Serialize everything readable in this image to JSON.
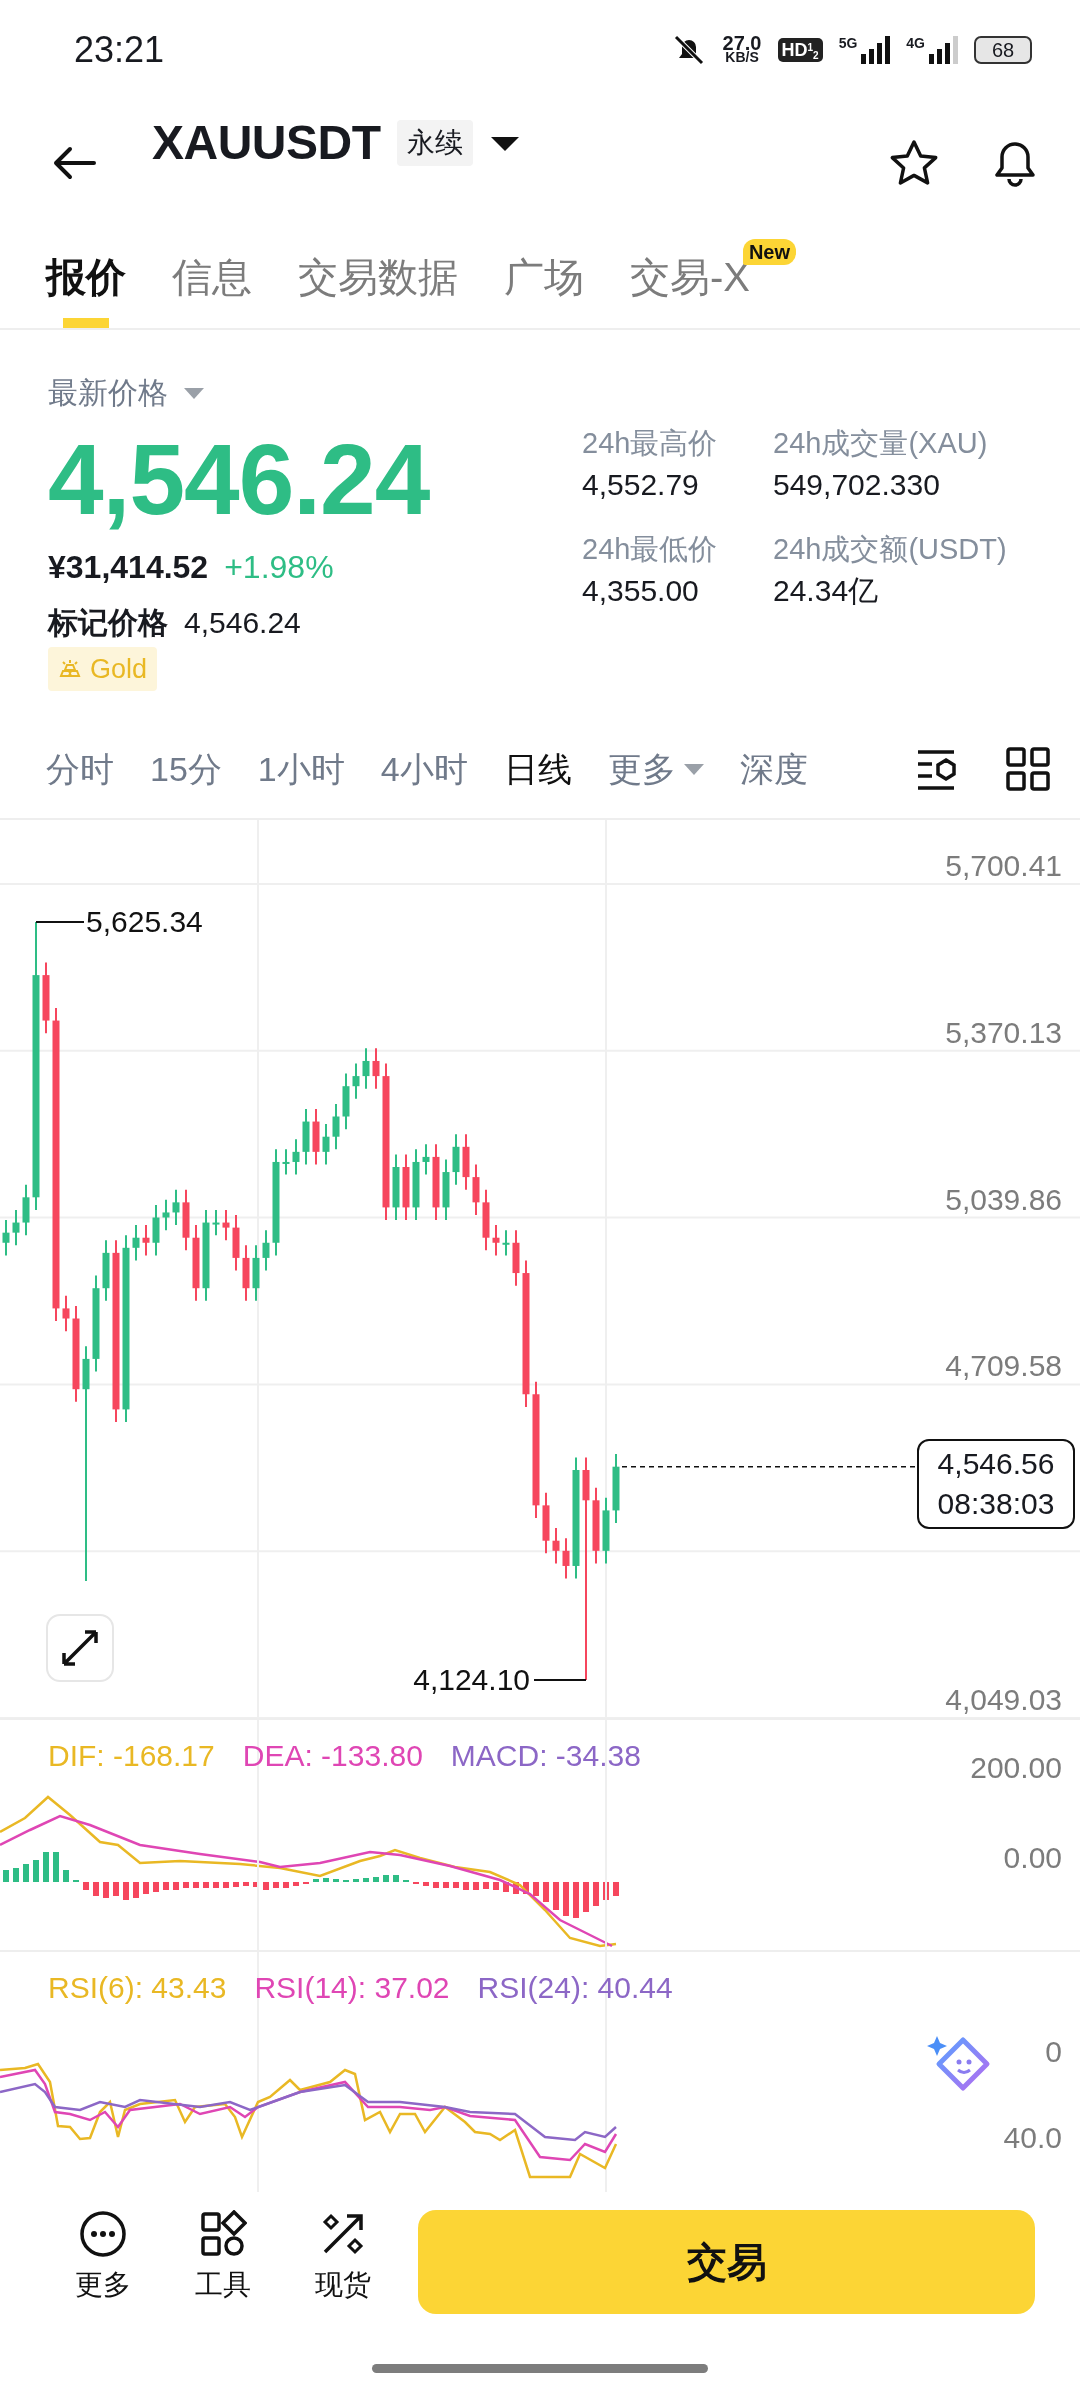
{
  "status_bar": {
    "time": "23:21",
    "net_speed": "27.0",
    "net_unit": "KB/S",
    "hd": "HD$^{1}$$_{2}$",
    "sim_1": "5G",
    "sim_2": "4G",
    "battery": "68"
  },
  "header": {
    "symbol": "XAUUSDT",
    "contract_type": "永续"
  },
  "tabs": [
    {
      "label": "报价",
      "selected": true
    },
    {
      "label": "信息",
      "selected": false
    },
    {
      "label": "交易数据",
      "selected": false
    },
    {
      "label": "广场",
      "selected": false
    },
    {
      "label": "交易-X",
      "selected": false,
      "badge": "New"
    }
  ],
  "price": {
    "label": "最新价格",
    "last": "4,546.24",
    "cny": "¥31,414.52",
    "change": "+1.98%",
    "mark_label": "标记价格",
    "mark": "4,546.24",
    "tag": "Gold"
  },
  "stats": [
    {
      "label": "24h最高价",
      "value": "4,552.79"
    },
    {
      "label": "24h成交量(XAU)",
      "value": "549,702.330"
    },
    {
      "label": "24h最低价",
      "value": "4,355.00"
    },
    {
      "label": "24h成交额(USDT)",
      "value": "24.34亿"
    }
  ],
  "intervals": [
    {
      "label": "分时",
      "selected": false
    },
    {
      "label": "15分",
      "selected": false
    },
    {
      "label": "1小时",
      "selected": false
    },
    {
      "label": "4小时",
      "selected": false
    },
    {
      "label": "日线",
      "selected": true
    }
  ],
  "more_menu": "更多",
  "depth_tab": "深度",
  "chart": {
    "y_labels": [
      "5,700.41",
      "5,370.13",
      "5,039.86",
      "4,709.58",
      "4,049.03"
    ],
    "high_label": "5,625.34",
    "low_label": "4,124.10",
    "last_price": "4,546.56",
    "countdown": "08:38:03"
  },
  "macd": {
    "legend": [
      {
        "text": "DIF: -168.17",
        "color": "#e9b824"
      },
      {
        "text": "DEA: -133.80",
        "color": "#df46b4"
      },
      {
        "text": "MACD: -34.38",
        "color": "#8c67c6"
      }
    ],
    "y_labels": [
      "200.00",
      "0.00"
    ]
  },
  "rsi": {
    "legend": [
      {
        "text": "RSI(6): 43.43",
        "color": "#e9b824"
      },
      {
        "text": "RSI(14): 37.02",
        "color": "#df46b4"
      },
      {
        "text": "RSI(24): 40.44",
        "color": "#8c67c6"
      }
    ],
    "y_labels": [
      "0",
      "40.0"
    ]
  },
  "bottom_bar": {
    "actions": [
      {
        "kind": "more",
        "label": "更多"
      },
      {
        "kind": "tools",
        "label": "工具"
      },
      {
        "kind": "spot",
        "label": "现货"
      }
    ],
    "trade_button": "交易"
  }
}
